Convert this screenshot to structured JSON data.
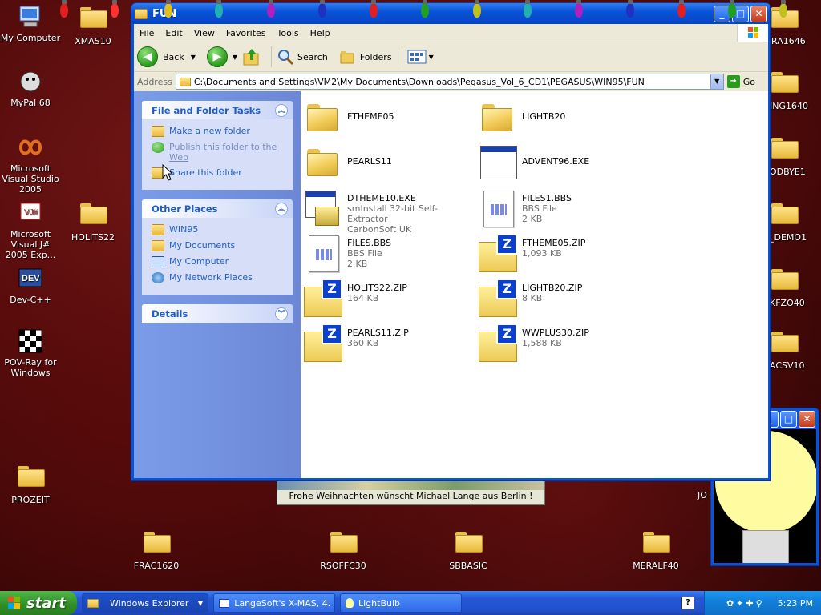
{
  "desktop_icons": [
    {
      "label": "My Computer",
      "icon": "computer-icon"
    },
    {
      "label": "XMAS10",
      "icon": "folder-icon"
    },
    {
      "label": "MyPal 68",
      "icon": "mypal-icon"
    },
    {
      "label": "Microsoft Visual Studio 2005",
      "icon": "visual-studio-icon"
    },
    {
      "label": "Microsoft Visual J# 2005 Exp...",
      "icon": "vjsharp-icon"
    },
    {
      "label": "HOLITS22",
      "icon": "folder-icon"
    },
    {
      "label": "Dev-C++",
      "icon": "devcpp-icon"
    },
    {
      "label": "POV-Ray for Windows",
      "icon": "povray-icon"
    },
    {
      "label": "PROZEIT",
      "icon": "folder-icon"
    },
    {
      "label": "FRAC1620",
      "icon": "folder-icon"
    },
    {
      "label": "RSOFFC30",
      "icon": "folder-icon"
    },
    {
      "label": "SBBASIC",
      "icon": "folder-icon"
    },
    {
      "label": "MERALF40",
      "icon": "folder-icon"
    },
    {
      "label": "RA1646",
      "icon": "folder-icon"
    },
    {
      "label": "ING1640",
      "icon": "folder-icon"
    },
    {
      "label": "ODBYE1",
      "icon": "folder-icon"
    },
    {
      "label": "_DEMO1",
      "icon": "folder-icon"
    },
    {
      "label": "KFZO40",
      "icon": "folder-icon"
    },
    {
      "label": "ACSV10",
      "icon": "folder-icon"
    },
    {
      "label": "JO",
      "icon": "folder-icon"
    }
  ],
  "window": {
    "title": "FUN",
    "menu": [
      "File",
      "Edit",
      "View",
      "Favorites",
      "Tools",
      "Help"
    ],
    "toolbar": {
      "back": "Back",
      "search": "Search",
      "folders": "Folders"
    },
    "address": {
      "label": "Address",
      "value": "C:\\Documents and Settings\\VM2\\My Documents\\Downloads\\Pegasus_Vol_6_CD1\\PEGASUS\\WIN95\\FUN",
      "go": "Go"
    }
  },
  "tasks_panel": {
    "title": "File and Folder Tasks",
    "items": [
      "Make a new folder",
      "Publish this folder to the Web",
      "Share this folder"
    ]
  },
  "places_panel": {
    "title": "Other Places",
    "items": [
      "WIN95",
      "My Documents",
      "My Computer",
      "My Network Places"
    ]
  },
  "details_panel": {
    "title": "Details"
  },
  "files": [
    {
      "name": "FTHEME05",
      "type": "folder",
      "line2": "",
      "line3": ""
    },
    {
      "name": "LIGHTB20",
      "type": "folder",
      "line2": "",
      "line3": ""
    },
    {
      "name": "PEARLS11",
      "type": "folder",
      "line2": "",
      "line3": ""
    },
    {
      "name": "ADVENT96.EXE",
      "type": "exe",
      "line2": "",
      "line3": ""
    },
    {
      "name": "DTHEME10.EXE",
      "type": "installer",
      "line2": "smInstall 32-bit Self-Extractor",
      "line3": "CarbonSoft UK"
    },
    {
      "name": "FILES1.BBS",
      "type": "doc",
      "line2": "BBS File",
      "line3": "2 KB"
    },
    {
      "name": "FILES.BBS",
      "type": "doc",
      "line2": "BBS File",
      "line3": "2 KB"
    },
    {
      "name": "FTHEME05.ZIP",
      "type": "zip",
      "line2": "1,093 KB",
      "line3": ""
    },
    {
      "name": "HOLITS22.ZIP",
      "type": "zip",
      "line2": "164 KB",
      "line3": ""
    },
    {
      "name": "LIGHTB20.ZIP",
      "type": "zip",
      "line2": "8 KB",
      "line3": ""
    },
    {
      "name": "PEARLS11.ZIP",
      "type": "zip",
      "line2": "360 KB",
      "line3": ""
    },
    {
      "name": "WWPLUS30.ZIP",
      "type": "zip",
      "line2": "1,588 KB",
      "line3": ""
    }
  ],
  "banner": {
    "text": "Frohe Weihnachten wünscht Michael Lange aus Berlin !"
  },
  "taskbar": {
    "start": "start",
    "tasks": [
      "Windows Explorer",
      "LangeSoft's X-MAS, 4...",
      "LightBulb"
    ],
    "clock": "5:23 PM"
  },
  "colors": {
    "xp_blue": "#0a53d6",
    "link_blue": "#215dc6",
    "desktop_red": "#5a0d0d"
  }
}
